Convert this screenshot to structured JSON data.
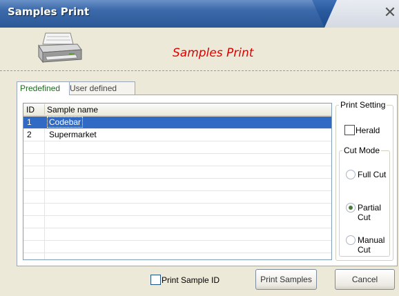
{
  "window": {
    "title": "Samples Print",
    "close_glyph": "✕"
  },
  "header": {
    "title": "Samples Print",
    "icon": "printer-icon"
  },
  "tabs": [
    {
      "label": "Predefined",
      "active": true
    },
    {
      "label": "User defined",
      "active": false
    }
  ],
  "list": {
    "columns": {
      "id": "ID",
      "name": "Sample name"
    },
    "rows": [
      {
        "id": "1",
        "name": "Codebar",
        "selected": true
      },
      {
        "id": "2",
        "name": "Supermarket",
        "selected": false
      }
    ]
  },
  "print_setting": {
    "group_label": "Print Setting",
    "herald_label": "Herald",
    "herald_checked": false,
    "cut_mode": {
      "group_label": "Cut Mode",
      "options": [
        {
          "label": "Full Cut",
          "selected": false
        },
        {
          "label": "Partial Cut",
          "selected": true
        },
        {
          "label": "Manual Cut",
          "selected": false
        }
      ]
    }
  },
  "footer": {
    "print_sample_id_label": "Print Sample ID",
    "print_sample_id_checked": false,
    "print_button": "Print Samples",
    "cancel_button": "Cancel"
  },
  "colors": {
    "title_blue": "#2a5a9e",
    "header_red": "#e00000",
    "selection": "#316ac5"
  }
}
